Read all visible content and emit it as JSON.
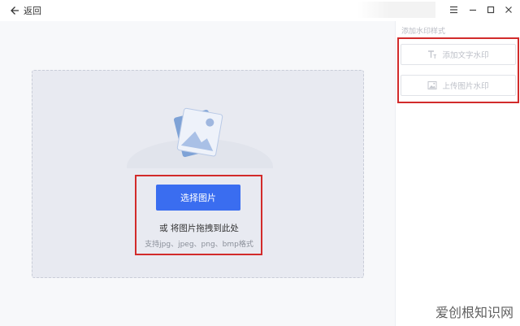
{
  "titlebar": {
    "back_label": "返回",
    "controls": [
      "menu-icon",
      "minimize-icon",
      "maximize-icon",
      "close-icon"
    ]
  },
  "upload": {
    "select_button": "选择图片",
    "drag_hint": "或 将图片拖拽到此处",
    "formats": "支持jpg、jpeg、png、bmp格式"
  },
  "sidebar": {
    "title": "添加水印样式",
    "buttons": [
      {
        "label": "添加文字水印",
        "icon": "text-icon"
      },
      {
        "label": "上传图片水印",
        "icon": "image-icon"
      }
    ]
  },
  "watermark": "爱创根知识网",
  "colors": {
    "accent": "#3a6df0",
    "highlight_box": "#d22b2b",
    "dropzone_bg": "#e8eaf1"
  }
}
